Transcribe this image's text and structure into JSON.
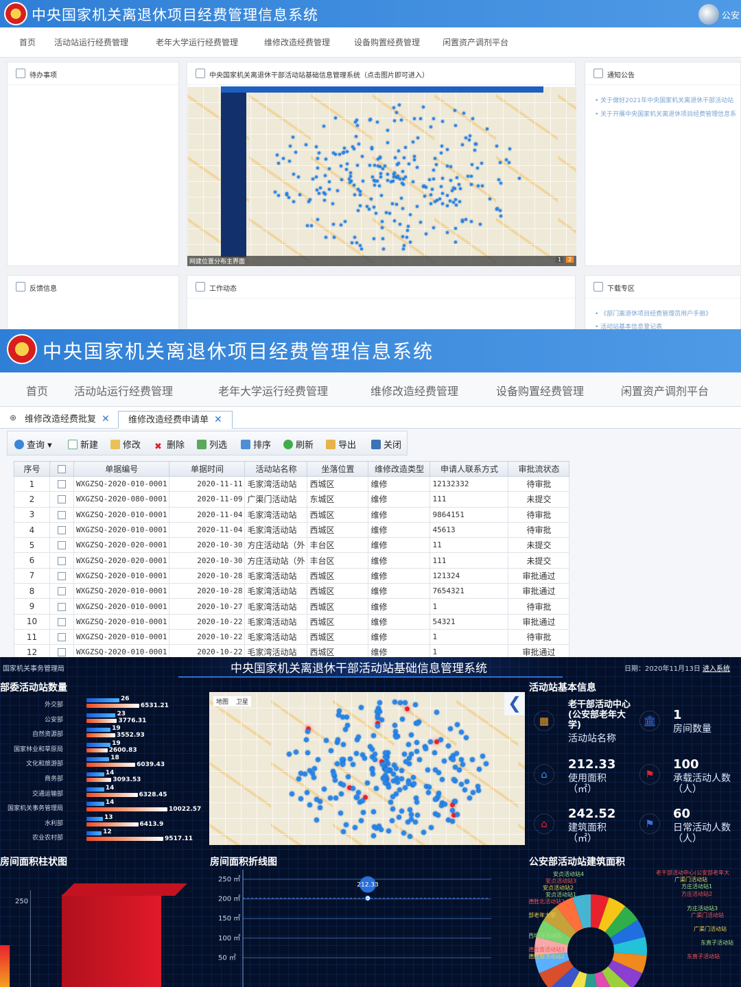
{
  "p1": {
    "title": "中央国家机关离退休项目经费管理信息系统",
    "user": "公安",
    "nav": [
      "首页",
      "活动站运行经费管理",
      "老年大学运行经费管理",
      "维修改造经费管理",
      "设备购置经费管理",
      "闲置资产调剂平台"
    ],
    "cards": {
      "todo": "待办事项",
      "map": "中央国家机关离退休干部活动站基础信息管理系统（点击图片即可进入）",
      "notice": "通知公告",
      "feedback": "反馈信息",
      "work": "工作动态",
      "download": "下载专区"
    },
    "notices": [
      "关于做好2021年中央国家机关离退休干部活动站",
      "关于开展中央国家机关离退休项目经费管理信息系"
    ],
    "downloads": [
      "《部门离退休项目经费管理员用户手册》",
      "活动站基本信息登记表"
    ],
    "map_caption": "网建位置分布主界面",
    "map_pages": [
      "1",
      "2"
    ]
  },
  "p2": {
    "title": "中央国家机关离退休项目经费管理信息系统",
    "nav": [
      "首页",
      "活动站运行经费管理",
      "老年大学运行经费管理",
      "维修改造经费管理",
      "设备购置经费管理",
      "闲置资产调剂平台"
    ],
    "tabs": [
      "维修改造经费批复",
      "维修改造经费申请单"
    ],
    "toolbar": [
      "查询",
      "新建",
      "修改",
      "删除",
      "列选",
      "排序",
      "刷新",
      "导出",
      "关闭"
    ],
    "columns": [
      "序号",
      "",
      "单据编号",
      "单据时间",
      "活动站名称",
      "坐落位置",
      "维修改造类型",
      "申请人联系方式",
      "审批流状态"
    ],
    "rows": [
      [
        "1",
        "WXGZSQ-2020-010-0001",
        "2020-11-11",
        "毛家湾活动站",
        "西城区",
        "维修",
        "12132332",
        "待审批"
      ],
      [
        "2",
        "WXGZSQ-2020-080-0001",
        "2020-11-09",
        "广渠门活动站",
        "东城区",
        "维修",
        "111",
        "未提交"
      ],
      [
        "3",
        "WXGZSQ-2020-010-0001",
        "2020-11-04",
        "毛家湾活动站",
        "西城区",
        "维修",
        "9864151",
        "待审批"
      ],
      [
        "4",
        "WXGZSQ-2020-010-0001",
        "2020-11-04",
        "毛家湾活动站",
        "西城区",
        "维修",
        "45613",
        "待审批"
      ],
      [
        "5",
        "WXGZSQ-2020-020-0001",
        "2020-10-30",
        "方庄活动站（外",
        "丰台区",
        "维修",
        "11",
        "未提交"
      ],
      [
        "6",
        "WXGZSQ-2020-020-0001",
        "2020-10-30",
        "方庄活动站（外",
        "丰台区",
        "维修",
        "111",
        "未提交"
      ],
      [
        "7",
        "WXGZSQ-2020-010-0001",
        "2020-10-28",
        "毛家湾活动站",
        "西城区",
        "维修",
        "121324",
        "审批通过"
      ],
      [
        "8",
        "WXGZSQ-2020-010-0001",
        "2020-10-28",
        "毛家湾活动站",
        "西城区",
        "维修",
        "7654321",
        "审批通过"
      ],
      [
        "9",
        "WXGZSQ-2020-010-0001",
        "2020-10-27",
        "毛家湾活动站",
        "西城区",
        "维修",
        "1",
        "待审批"
      ],
      [
        "10",
        "WXGZSQ-2020-010-0001",
        "2020-10-22",
        "毛家湾活动站",
        "西城区",
        "维修",
        "54321",
        "审批通过"
      ],
      [
        "11",
        "WXGZSQ-2020-010-0001",
        "2020-10-22",
        "毛家湾活动站",
        "西城区",
        "维修",
        "1",
        "待审批"
      ],
      [
        "12",
        "WXGZSQ-2020-010-0001",
        "2020-10-22",
        "毛家湾活动站",
        "西城区",
        "维修",
        "1",
        "审批通过"
      ]
    ]
  },
  "p3": {
    "org": "国家机关事务管理局",
    "title": "中央国家机关离退休干部活动站基础信息管理系统",
    "date": "日期：2020年11月13日",
    "enter": "进入系统",
    "bar_title": "部委活动站数量",
    "bars": [
      {
        "name": "外交部",
        "count": 26,
        "area": 6531.21
      },
      {
        "name": "公安部",
        "count": 23,
        "area": 3776.31
      },
      {
        "name": "自然资源部",
        "count": 19,
        "area": 3552.93
      },
      {
        "name": "国家林业和草原局",
        "count": 19,
        "area": 2600.83
      },
      {
        "name": "文化和旅游部",
        "count": 18,
        "area": 6039.43
      },
      {
        "name": "商务部",
        "count": 14,
        "area": 3093.53
      },
      {
        "name": "交通运输部",
        "count": 14,
        "area": 6328.45
      },
      {
        "name": "国家机关事务管理局",
        "count": 14,
        "area": 10022.57
      },
      {
        "name": "水利部",
        "count": 13,
        "area": 6413.9
      },
      {
        "name": "农业农村部",
        "count": 12,
        "area": 9517.11
      }
    ],
    "map_tabs": [
      "地图",
      "卫星"
    ],
    "info_title": "活动站基本信息",
    "info": {
      "name_val": "老干部活动中心(公安部老年大学)",
      "name_lab": "活动站名称",
      "rooms_val": "1",
      "rooms_lab": "房间数量",
      "use_val": "212.33",
      "use_lab": "使用面积（㎡）",
      "cap_val": "100",
      "cap_lab": "承载活动人数（人）",
      "build_val": "242.52",
      "build_lab": "建筑面积（㎡）",
      "daily_val": "60",
      "daily_lab": "日常活动人数（人）"
    },
    "col_title": "房间面积柱状图",
    "col_tick": "250",
    "line_title": "房间面积折线图",
    "line_ticks": [
      "250 ㎡",
      "200 ㎡",
      "150 ㎡",
      "100 ㎡",
      "50 ㎡"
    ],
    "line_point": "212.33",
    "pie_title": "公安部活动站建筑面积",
    "pie_labels": [
      "老干部活动中心(公安部老年大",
      "广渠门活动站",
      "方庄活动站1",
      "方庄活动站2",
      "安贞活动站5",
      "安贞活动站4",
      "安贞活动站3",
      "安贞活动站2",
      "安贞活动站1",
      "德胜北活动站2",
      "部老年大学",
      "西坝河活动站",
      "德胜南活动站3",
      "德胜南活动站2",
      "方庄活动站3",
      "广渠门活动站",
      "广渠门活动站",
      "东直子活动站",
      "东直子活动站"
    ]
  },
  "chart_data": [
    {
      "type": "bar",
      "title": "部委活动站数量",
      "categories": [
        "外交部",
        "公安部",
        "自然资源部",
        "国家林业和草原局",
        "文化和旅游部",
        "商务部",
        "交通运输部",
        "国家机关事务管理局",
        "水利部",
        "农业农村部"
      ],
      "series": [
        {
          "values": [
            26,
            23,
            19,
            19,
            18,
            14,
            14,
            14,
            13,
            12
          ]
        },
        {
          "values": [
            6531.21,
            3776.31,
            3552.93,
            2600.83,
            6039.43,
            3093.53,
            6328.45,
            10022.57,
            6413.9,
            9517.11
          ]
        }
      ]
    },
    {
      "type": "line",
      "title": "房间面积折线图",
      "y_ticks": [
        50,
        100,
        150,
        200,
        250
      ],
      "values": [
        212.33
      ]
    },
    {
      "type": "pie",
      "title": "公安部活动站建筑面积"
    }
  ],
  "colors": {
    "header": "#3a88dc",
    "accent_red": "#e8222d",
    "dot_blue": "#2a86e6",
    "dark_bg": "#04102a"
  }
}
